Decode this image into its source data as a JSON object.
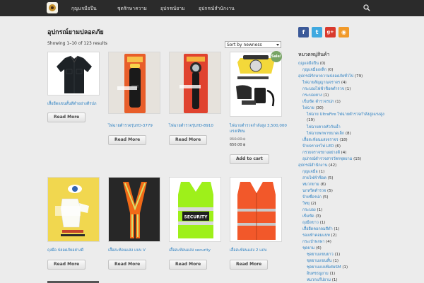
{
  "nav": {
    "items": [
      "กุญแจมือปืน",
      "ชุดรักษาความ",
      "อุปกรณ์ยาม",
      "อุปกรณ์สำนักงาน"
    ]
  },
  "shop": {
    "title": "อุปกรณ์ยามปลอดภัย",
    "result_count": "Showing 1–10 of 123 results",
    "sort_value": "Sort by newness",
    "sale_badge": "Sale!",
    "products": [
      {
        "name": "เสื้อยืดแขนสั้นสีดำอย่างดีรปภ",
        "button": "Read More"
      },
      {
        "name": "ไฟฉายตำรวจรุ่นYD-3779",
        "button": "Read More"
      },
      {
        "name": "ไฟฉายตำรวจรุ่นYD-8910",
        "button": "Read More"
      },
      {
        "name": "ไฟฉายตำรวจกำลังสูง 3,500,000 แรงเทียน",
        "price_old": "950.00 ฿",
        "price": "650.00 ฿",
        "button": "Add to cart"
      },
      {
        "name": "ถุงมือ ปลอดภัยอย่างดี",
        "button": "Read More"
      },
      {
        "name": "เสื้อสะท้อนแสง แบบ V",
        "button": "Read More"
      },
      {
        "name": "เสื้อสะท้อนแสง security",
        "button": "Read More"
      },
      {
        "name": "เสื้อสะท้อนแสง 2 แถบ",
        "button": "Read More"
      }
    ]
  },
  "social": [
    {
      "icon": "facebook-icon",
      "glyph": "f",
      "color": "#3b5998"
    },
    {
      "icon": "twitter-icon",
      "glyph": "t",
      "color": "#3fa9e0"
    },
    {
      "icon": "google-plus-icon",
      "glyph": "g+",
      "color": "#d9392c"
    },
    {
      "icon": "rss-icon",
      "glyph": "◉",
      "color": "#f19a2a"
    }
  ],
  "sidebar": {
    "title": "หมวดหมู่สินค้า",
    "categories": [
      {
        "label": "กุญแจมือปืน",
        "count": "(0)"
      },
      {
        "label": "กุญแจมือเหล็ก",
        "count": "(0)"
      },
      {
        "label": "อุปกรณ์รักษาความปลอดภัยทั่วไป",
        "count": "(79)"
      },
      {
        "label": "ไฟฉายสัญญาณจราจร",
        "count": "(4)"
      },
      {
        "label": "กระบองไฟฟ้าช็อตตำรวจ",
        "count": "(1)"
      },
      {
        "label": "กระบองยาง",
        "count": "(1)"
      },
      {
        "label": "เข็มขัด ตำรวจรปภ",
        "count": "(1)"
      },
      {
        "label": "ไฟฉาย",
        "count": "(30)"
      },
      {
        "label": "ไฟฉาย UltraFire ไฟฉายตำรวจกำลังสูงแรงสูง",
        "count": ""
      },
      {
        "label": "",
        "count": "(19)"
      },
      {
        "label": "ไฟฉายคาดหัวกันน้ำ",
        "count": ""
      },
      {
        "label": "ไฟฉายพกพาขนาดเล็ก",
        "count": "(8)"
      },
      {
        "label": "เสื้อสะท้อนแสงจราจร",
        "count": "(18)"
      },
      {
        "label": "ป้ายจราจรไฟ LED",
        "count": "(6)"
      },
      {
        "label": "กรวยจราจรยางอย่างดี",
        "count": "(4)"
      },
      {
        "label": "อุปกรณ์ตำรวจสารวัตรชุดยาม",
        "count": "(15)"
      },
      {
        "label": "อุปกรณ์สำนักงาน",
        "count": "(42)"
      },
      {
        "label": "กุญแจมือ",
        "count": "(1)"
      },
      {
        "label": "สายไฟฟ้าช็อต",
        "count": "(5)"
      },
      {
        "label": "หมวกยาม",
        "count": "(6)"
      },
      {
        "label": "นกหวีดตำรวจ",
        "count": "(5)"
      },
      {
        "label": "ป้ายชื่อรปภ",
        "count": "(5)"
      },
      {
        "label": "วิทยุ",
        "count": "(2)"
      },
      {
        "label": "กระบอง",
        "count": "(1)"
      },
      {
        "label": "เข็มขัด",
        "count": "(3)"
      },
      {
        "label": "ถุงมือขาว",
        "count": "(1)"
      },
      {
        "label": "เสื้อยืดคอกลมสีดำ",
        "count": "(1)"
      },
      {
        "label": "รองเท้าคอมแบท",
        "count": "(2)"
      },
      {
        "label": "กระเป๋าพกพา",
        "count": "(4)"
      },
      {
        "label": "ชุดยาม",
        "count": "(6)"
      },
      {
        "label": "ชุดยามแขนยาว",
        "count": "(1)"
      },
      {
        "label": "ชุดยามแขนสั้น",
        "count": "(1)"
      },
      {
        "label": "ชุดยามแบบพิเศษSM",
        "count": "(1)"
      },
      {
        "label": "อินทรธนูยาม",
        "count": "(1)"
      },
      {
        "label": "หมวกแก๊ปยาม",
        "count": "(1)"
      }
    ]
  }
}
